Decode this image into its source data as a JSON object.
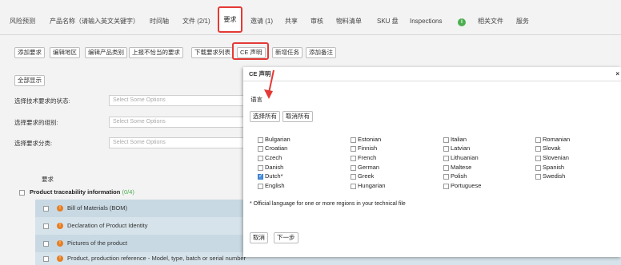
{
  "tabs": [
    {
      "label": "风险预测"
    },
    {
      "label": "产品名称（请输入英文关键字）"
    },
    {
      "label": "时间轴"
    },
    {
      "label": "文件 (2/1)"
    },
    {
      "label": "要求"
    },
    {
      "label": "邀请 (1)"
    },
    {
      "label": "共享"
    },
    {
      "label": "审核"
    },
    {
      "label": "物料清单"
    },
    {
      "label": "SKU 盘"
    },
    {
      "label": "Inspections"
    },
    {
      "label": "i"
    },
    {
      "label": "相关文件"
    },
    {
      "label": "服务"
    }
  ],
  "toolbar": [
    {
      "label": "添加要求"
    },
    {
      "label": "编辑地区"
    },
    {
      "label": "编辑产品类别"
    },
    {
      "label": "上报不恰当的要求"
    },
    {
      "label": "下载要求列表"
    },
    {
      "label": "CE 声明"
    },
    {
      "label": "新增任务"
    },
    {
      "label": "添加备注"
    }
  ],
  "filters": {
    "show_all": "全部显示",
    "status_label": "选择技术要求的状态:",
    "group_label": "选择要求的组别:",
    "category_label": "选择要求分类:",
    "placeholder": "Select Some Options"
  },
  "requirements": {
    "header": "要求",
    "group_title": "Product traceability information",
    "group_count": "(0/4)",
    "items": [
      {
        "label": "Bill of Materials (BOM)"
      },
      {
        "label": "Declaration of Product Identity"
      },
      {
        "label": "Pictures of the product"
      },
      {
        "label": "Product, production reference - Model, type, batch or serial number"
      }
    ]
  },
  "modal": {
    "title": "CE 声明",
    "close": "×",
    "language_title": "语言",
    "select_all": "选择所有",
    "deselect_all": "取消所有",
    "languages": [
      {
        "name": "Bulgarian",
        "checked": false
      },
      {
        "name": "Croatian",
        "checked": false
      },
      {
        "name": "Czech",
        "checked": false
      },
      {
        "name": "Danish",
        "checked": false
      },
      {
        "name": "Dutch*",
        "checked": true
      },
      {
        "name": "English",
        "checked": false
      },
      {
        "name": "Estonian",
        "checked": false
      },
      {
        "name": "Finnish",
        "checked": false
      },
      {
        "name": "French",
        "checked": false
      },
      {
        "name": "German",
        "checked": false
      },
      {
        "name": "Greek",
        "checked": false
      },
      {
        "name": "Hungarian",
        "checked": false
      },
      {
        "name": "Italian",
        "checked": false
      },
      {
        "name": "Latvian",
        "checked": false
      },
      {
        "name": "Lithuanian",
        "checked": false
      },
      {
        "name": "Maltese",
        "checked": false
      },
      {
        "name": "Polish",
        "checked": false
      },
      {
        "name": "Portuguese",
        "checked": false
      },
      {
        "name": "Romanian",
        "checked": false
      },
      {
        "name": "Slovak",
        "checked": false
      },
      {
        "name": "Slovenian",
        "checked": false
      },
      {
        "name": "Spanish",
        "checked": false
      },
      {
        "name": "Swedish",
        "checked": false
      }
    ],
    "footnote": "* Official language for one or more regions in your technical file",
    "cancel": "取消",
    "next": "下一步"
  },
  "colors": {
    "highlight": "#e53935",
    "accent_green": "#4caf50",
    "row_bg": "#c8d9e3",
    "warn": "#e67e22"
  }
}
